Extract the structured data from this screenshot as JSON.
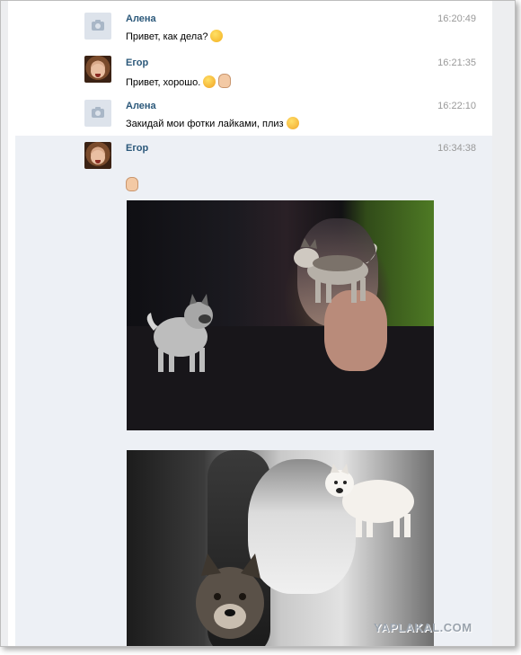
{
  "messages": [
    {
      "sender": "Алена",
      "time": "16:20:49",
      "text": "Привет, как дела?",
      "emoji": [
        "smile-icon"
      ]
    },
    {
      "sender": "Егор",
      "time": "16:21:35",
      "text": "Привет, хорошо.",
      "emoji": [
        "smile-big-icon",
        "ok-hand-icon"
      ]
    },
    {
      "sender": "Алена",
      "time": "16:22:10",
      "text": "Закидай мои фотки лайками, плиз",
      "emoji": [
        "kiss-icon"
      ]
    },
    {
      "sender": "Егор",
      "time": "16:34:38",
      "text": "",
      "emoji": [
        "ok-hand-icon"
      ],
      "attachments": 2
    }
  ],
  "watermark": "YAPLAKAL.COM",
  "colors": {
    "name": "#2b587a",
    "time": "#999999",
    "highlight": "#edf0f5",
    "background": "#edeef0"
  }
}
